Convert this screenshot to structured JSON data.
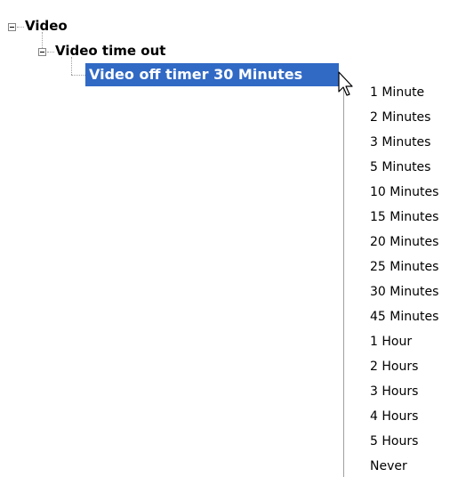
{
  "tree": {
    "root": {
      "label": "Video",
      "expander": "minus"
    },
    "child": {
      "label": "Video time out",
      "expander": "minus"
    },
    "selected_item": {
      "label": "Video off timer 30 Minutes"
    }
  },
  "dropdown": {
    "options": [
      "1 Minute",
      "2 Minutes",
      "3 Minutes",
      "5 Minutes",
      "10 Minutes",
      "15 Minutes",
      "20 Minutes",
      "25 Minutes",
      "30 Minutes",
      "45 Minutes",
      "1 Hour",
      "2 Hours",
      "3 Hours",
      "4 Hours",
      "5 Hours",
      "Never"
    ]
  },
  "colors": {
    "selection": "#316ac5",
    "selection_text": "#ffffff",
    "text": "#000000"
  },
  "icons": {
    "cursor": "arrow-pointer-icon",
    "expander": "tree-collapse-icon"
  }
}
